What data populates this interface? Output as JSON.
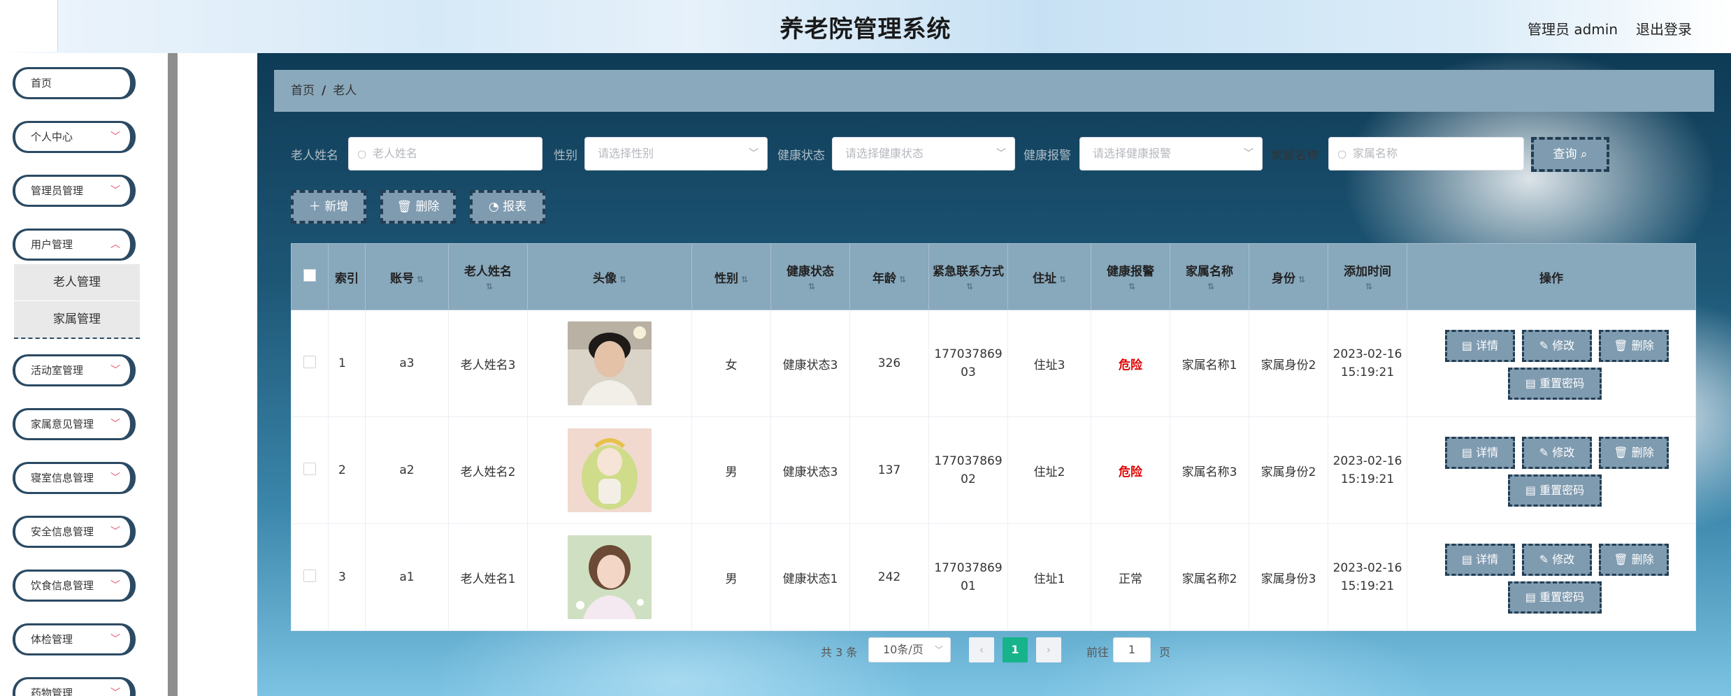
{
  "header": {
    "title": "养老院管理系统",
    "user_label": "管理员 admin",
    "logout": "退出登录"
  },
  "sidebar": {
    "items": [
      {
        "label": "首页",
        "has_arrow": false
      },
      {
        "label": "个人中心",
        "has_arrow": true
      },
      {
        "label": "管理员管理",
        "has_arrow": true
      },
      {
        "label": "用户管理",
        "has_arrow": true
      },
      {
        "label": "活动室管理",
        "has_arrow": true
      },
      {
        "label": "家属意见管理",
        "has_arrow": true
      },
      {
        "label": "寝室信息管理",
        "has_arrow": true
      },
      {
        "label": "安全信息管理",
        "has_arrow": true
      },
      {
        "label": "饮食信息管理",
        "has_arrow": true
      },
      {
        "label": "体检管理",
        "has_arrow": true
      },
      {
        "label": "药物管理",
        "has_arrow": true
      }
    ],
    "submenu": [
      "老人管理",
      "家属管理"
    ]
  },
  "breadcrumb": {
    "home": "首页",
    "separator": "/",
    "current": "老人"
  },
  "filters": {
    "name_label": "老人姓名",
    "name_placeholder": "老人姓名",
    "gender_label": "性别",
    "gender_placeholder": "请选择性别",
    "health_label": "健康状态",
    "health_placeholder": "请选择健康状态",
    "alert_label": "健康报警",
    "alert_placeholder": "请选择健康报警",
    "family_label": "家属名称",
    "family_placeholder": "家属名称",
    "query_button": "查询"
  },
  "actions": {
    "add": "新增",
    "delete": "删除",
    "report": "报表"
  },
  "table": {
    "headers": {
      "index": "索引",
      "account": "账号",
      "name": "老人姓名",
      "avatar": "头像",
      "gender": "性别",
      "health": "健康状态",
      "age": "年龄",
      "contact": "紧急联系方式",
      "address": "住址",
      "alert": "健康报警",
      "family": "家属名称",
      "identity": "身份",
      "added": "添加时间",
      "ops": "操作"
    },
    "rows": [
      {
        "index": "1",
        "account": "a3",
        "name": "老人姓名3",
        "gender": "女",
        "health": "健康状态3",
        "age": "326",
        "contact": "17703786903",
        "address": "住址3",
        "alert": "危险",
        "alert_status": "danger",
        "family": "家属名称1",
        "identity": "家属身份2",
        "added": "2023-02-16 15:19:21"
      },
      {
        "index": "2",
        "account": "a2",
        "name": "老人姓名2",
        "gender": "男",
        "health": "健康状态3",
        "age": "137",
        "contact": "17703786902",
        "address": "住址2",
        "alert": "危险",
        "alert_status": "danger",
        "family": "家属名称3",
        "identity": "家属身份2",
        "added": "2023-02-16 15:19:21"
      },
      {
        "index": "3",
        "account": "a1",
        "name": "老人姓名1",
        "gender": "男",
        "health": "健康状态1",
        "age": "242",
        "contact": "17703786901",
        "address": "住址1",
        "alert": "正常",
        "alert_status": "normal",
        "family": "家属名称2",
        "identity": "家属身份3",
        "added": "2023-02-16 15:19:21"
      }
    ],
    "row_buttons": {
      "detail": "详情",
      "edit": "修改",
      "delete": "删除",
      "reset": "重置密码"
    }
  },
  "pagination": {
    "total": "共 3 条",
    "page_size": "10条/页",
    "current": "1",
    "goto_label": "前往",
    "goto_value": "1",
    "page_suffix": "页"
  },
  "colors": {
    "accent": "#7f9bb0",
    "header_bg": "#88a8bc",
    "sidebar_border": "#2b4a63",
    "danger": "#e00000",
    "page_active": "#17b38a"
  }
}
